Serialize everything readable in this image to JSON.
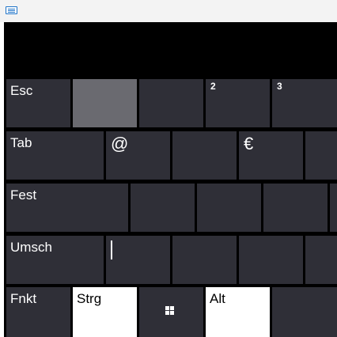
{
  "window": {
    "icon": "keyboard-icon"
  },
  "keys": {
    "row1": {
      "esc": "Esc",
      "num2": "2",
      "num3": "3"
    },
    "row2": {
      "tab": "Tab",
      "at": "@",
      "euro": "€"
    },
    "row3": {
      "fest": "Fest"
    },
    "row4": {
      "umsch": "Umsch",
      "pipe": "|"
    },
    "row5": {
      "fnkt": "Fnkt",
      "strg": "Strg",
      "win_icon": "windows-icon",
      "alt": "Alt"
    }
  },
  "colors": {
    "key_bg": "#2f2f37",
    "key_pressed": "#6a6a70",
    "key_highlight": "#ffffff",
    "keyboard_bg": "#000000",
    "icon_accent": "#1e73c8"
  }
}
